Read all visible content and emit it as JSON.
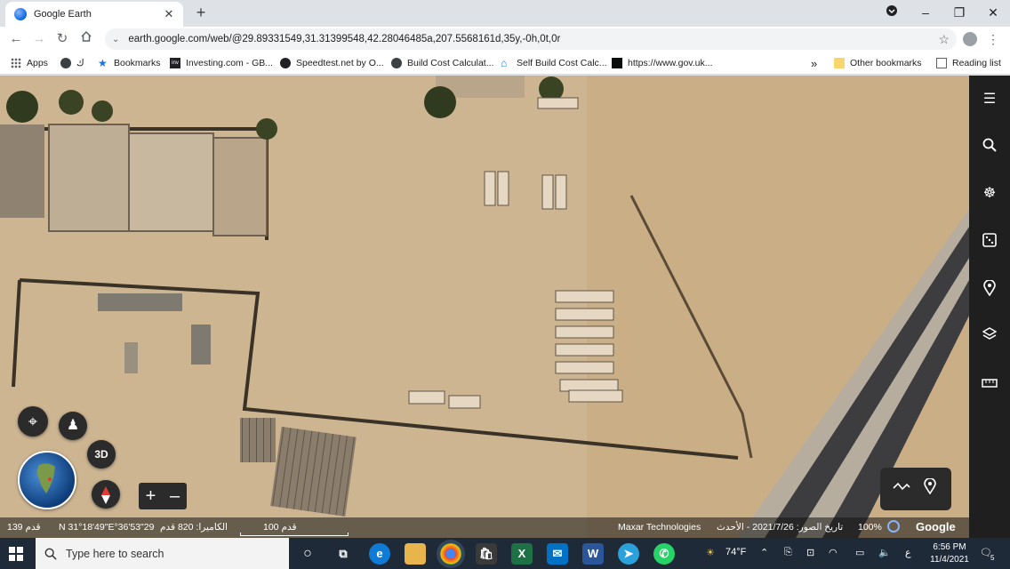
{
  "browser": {
    "tab_title": "Google Earth",
    "tab_close": "✕",
    "new_tab": "+",
    "url": "earth.google.com/web/@29.89331549,31.31399548,42.28046485a,207.5568161d,35y,-0h,0t,0r",
    "window_controls": [
      "–",
      "❐",
      "✕"
    ]
  },
  "bookmarks": {
    "items": [
      {
        "label": "Apps",
        "icon": "apps-grid-icon"
      },
      {
        "label": "ﻙ",
        "icon": "globe-icon"
      },
      {
        "label": "Bookmarks",
        "icon": "star-icon"
      },
      {
        "label": "Investing.com - GB...",
        "icon": "investing-icon"
      },
      {
        "label": "Speedtest.net by O...",
        "icon": "speedtest-icon"
      },
      {
        "label": "Build Cost Calculat...",
        "icon": "calc-icon"
      },
      {
        "label": "Self Build Cost Calc...",
        "icon": "house-icon"
      },
      {
        "label": "https://www.gov.uk...",
        "icon": "govuk-icon"
      }
    ],
    "overflow": "»",
    "other": "Other bookmarks",
    "reading_list": "Reading list"
  },
  "earth": {
    "nav_3d": "3D",
    "zoom_in": "+",
    "zoom_out": "–",
    "status": {
      "distance_ft": "139 قدم",
      "coords": "N 31°18'49\"E°36'53\"29",
      "camera": "الكاميرا: 820 قدم",
      "scale": "100 قدم",
      "attribution": "Maxar Technologies",
      "imagery_date": "تاريخ الصور: 2021/7/26 - الأحدث",
      "zoom_pct": "100%",
      "brand": "Google"
    }
  },
  "taskbar": {
    "search_placeholder": "Type here to search",
    "weather": "74°F",
    "lang": "ع",
    "time": "6:56 PM",
    "date": "11/4/2021",
    "notifications": "5"
  },
  "colors": {
    "sidebar": "#1f1f1f",
    "taskbar": "#1f2a38",
    "ground": "#cdb592"
  }
}
